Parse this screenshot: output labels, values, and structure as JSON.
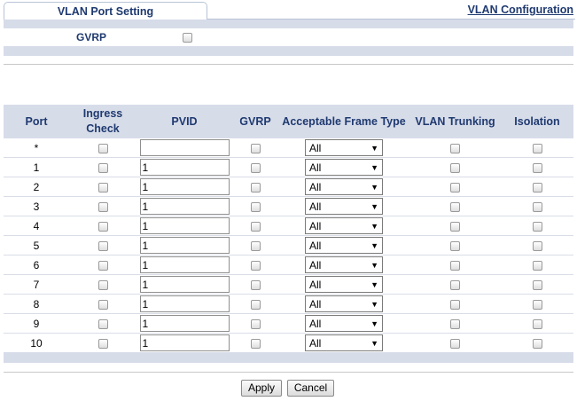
{
  "header": {
    "tab_label": "VLAN Port Setting",
    "link_label": "VLAN Configuration"
  },
  "gvrp": {
    "label": "GVRP",
    "checked": false
  },
  "table": {
    "headers": [
      "Port",
      "Ingress\nCheck",
      "PVID",
      "GVRP",
      "Acceptable Frame Type",
      "VLAN Trunking",
      "Isolation"
    ],
    "rows": [
      {
        "port": "*",
        "pvid": "",
        "frame_type": "All"
      },
      {
        "port": "1",
        "pvid": "1",
        "frame_type": "All"
      },
      {
        "port": "2",
        "pvid": "1",
        "frame_type": "All"
      },
      {
        "port": "3",
        "pvid": "1",
        "frame_type": "All"
      },
      {
        "port": "4",
        "pvid": "1",
        "frame_type": "All"
      },
      {
        "port": "5",
        "pvid": "1",
        "frame_type": "All"
      },
      {
        "port": "6",
        "pvid": "1",
        "frame_type": "All"
      },
      {
        "port": "7",
        "pvid": "1",
        "frame_type": "All"
      },
      {
        "port": "8",
        "pvid": "1",
        "frame_type": "All"
      },
      {
        "port": "9",
        "pvid": "1",
        "frame_type": "All"
      },
      {
        "port": "10",
        "pvid": "1",
        "frame_type": "All"
      }
    ]
  },
  "buttons": {
    "apply": "Apply",
    "cancel": "Cancel"
  },
  "colors": {
    "header_text": "#1f3a70",
    "band": "#d7dce9"
  }
}
